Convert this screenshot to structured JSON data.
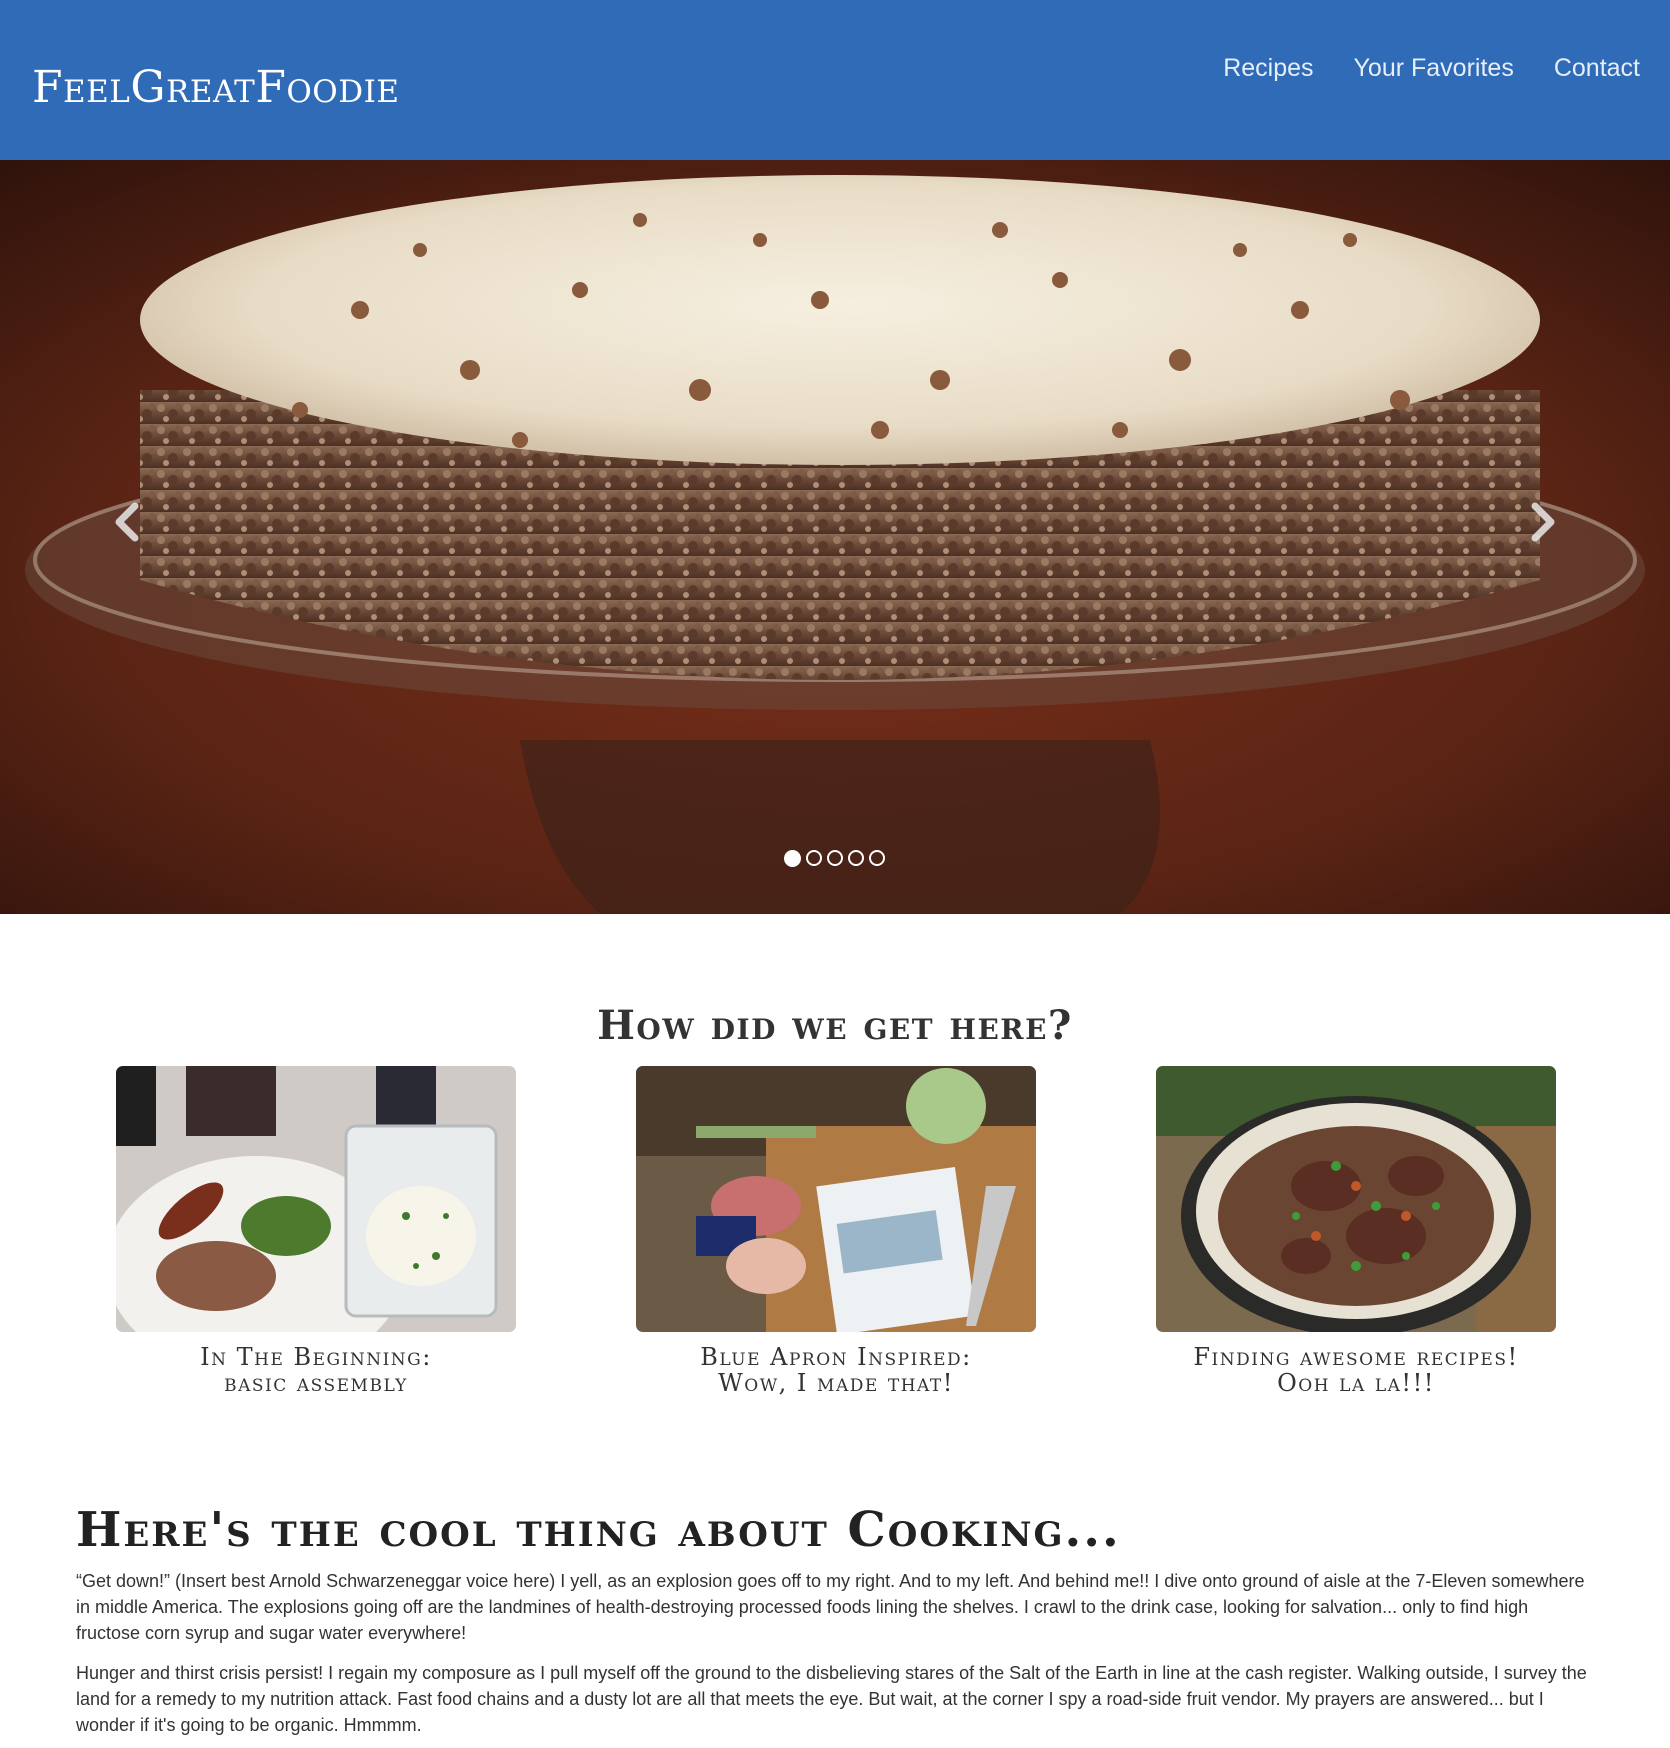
{
  "navbar": {
    "brand": "FeelGreatFoodie",
    "links": [
      "Recipes",
      "Your Favorites",
      "Contact"
    ]
  },
  "carousel": {
    "slide_count": 5,
    "active_index": 0,
    "prev_icon": "chevron-left-icon",
    "next_icon": "chevron-right-icon"
  },
  "journey": {
    "title": "How did we get here?",
    "cards": [
      {
        "line1": "In The Beginning:",
        "line2": "basic assembly"
      },
      {
        "line1": "Blue Apron Inspired:",
        "line2": "Wow, I made that!"
      },
      {
        "line1": "Finding awesome recipes!",
        "line2": "Ooh la la!!!"
      }
    ]
  },
  "article": {
    "title": "Here's the cool thing about Cooking...",
    "paragraphs": [
      "“Get down!” (Insert best Arnold Schwarzeneggar voice here) I yell, as an explosion goes off to my right. And to my left. And behind me!! I dive onto ground of aisle at the 7-Eleven somewhere in middle America. The explosions going off are the landmines of health-destroying processed foods lining the shelves. I crawl to the drink case, looking for salvation... only to find high fructose corn syrup and sugar water everywhere!",
      "Hunger and thirst crisis persist! I regain my composure as I pull myself off the ground to the disbelieving stares of the Salt of the Earth in line at the cash register. Walking outside, I survey the land for a remedy to my nutrition attack. Fast food chains and a dusty lot are all that meets the eye. But wait, at the corner I spy a road-side fruit vendor. My prayers are answered... but I wonder if it's going to be organic. Hmmmm."
    ]
  },
  "colors": {
    "navbar_bg": "#2f6bb7",
    "nav_text": "#e6eef8",
    "heading_text": "#333333"
  }
}
